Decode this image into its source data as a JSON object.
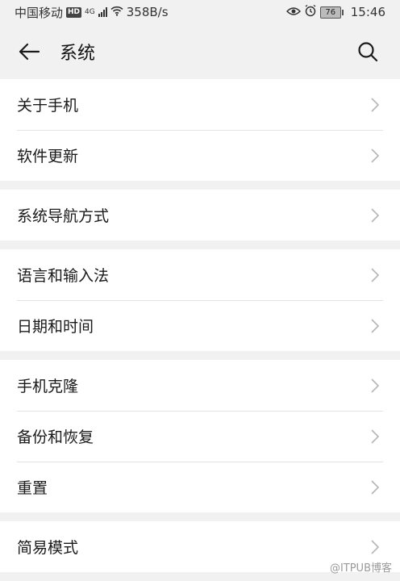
{
  "status_bar": {
    "carrier": "中国移动",
    "hd": "HD",
    "network": "4G",
    "speed": "358B/s",
    "battery": "76",
    "time": "15:46"
  },
  "header": {
    "title": "系统"
  },
  "groups": [
    {
      "items": [
        {
          "label": "关于手机"
        },
        {
          "label": "软件更新"
        }
      ]
    },
    {
      "items": [
        {
          "label": "系统导航方式"
        }
      ]
    },
    {
      "items": [
        {
          "label": "语言和输入法"
        },
        {
          "label": "日期和时间"
        }
      ]
    },
    {
      "items": [
        {
          "label": "手机克隆"
        },
        {
          "label": "备份和恢复"
        },
        {
          "label": "重置"
        }
      ]
    },
    {
      "items": [
        {
          "label": "简易模式"
        }
      ]
    }
  ],
  "watermark": "@ITPUB博客",
  "colors": {
    "background": "#f1f1f1",
    "card": "#ffffff",
    "divider": "#e3e3e3",
    "chevron": "#b5b5b5"
  }
}
